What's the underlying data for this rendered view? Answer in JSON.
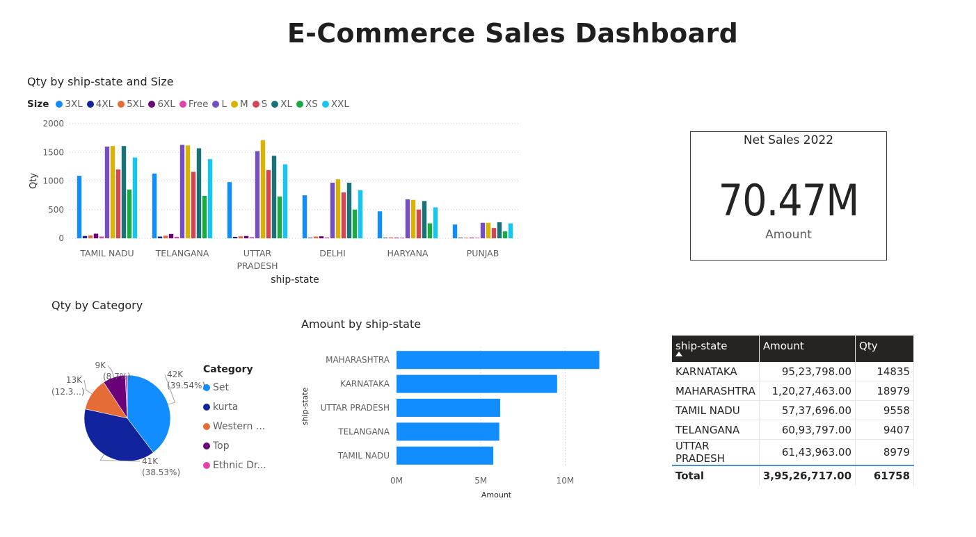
{
  "page": {
    "title": "E-Commerce Sales Dashboard"
  },
  "colors": {
    "3XL": "#118DFF",
    "4XL": "#12239E",
    "5XL": "#E66C37",
    "6XL": "#6B007B",
    "Free": "#E044A7",
    "L": "#744EC2",
    "M": "#D9B300",
    "S": "#D64550",
    "XL": "#197278",
    "XS": "#1AAB40",
    "XXL": "#15C6F4"
  },
  "size_chart": {
    "title": "Qty by ship-state and Size",
    "legend_title": "Size",
    "chart_data": {
      "type": "bar",
      "title": "Qty by ship-state and Size",
      "xlabel": "ship-state",
      "ylabel": "Qty",
      "ylim": [
        0,
        2000
      ],
      "yticks": [
        0,
        500,
        1000,
        1500,
        2000
      ],
      "grid": true,
      "legend": "top-left",
      "categories": [
        "TAMIL NADU",
        "TELANGANA",
        "UTTAR PRADESH",
        "DELHI",
        "HARYANA",
        "PUNJAB"
      ],
      "category_lines": [
        [
          "TAMIL NADU"
        ],
        [
          "TELANGANA"
        ],
        [
          "UTTAR",
          "PRADESH"
        ],
        [
          "DELHI"
        ],
        [
          "HARYANA"
        ],
        [
          "PUNJAB"
        ]
      ],
      "series": [
        {
          "name": "3XL",
          "values": [
            1090,
            1130,
            980,
            750,
            470,
            240
          ]
        },
        {
          "name": "4XL",
          "values": [
            40,
            30,
            25,
            10,
            10,
            10
          ]
        },
        {
          "name": "5XL",
          "values": [
            50,
            45,
            35,
            30,
            15,
            10
          ]
        },
        {
          "name": "6XL",
          "values": [
            80,
            75,
            40,
            35,
            10,
            10
          ]
        },
        {
          "name": "Free",
          "values": [
            30,
            25,
            20,
            15,
            10,
            10
          ]
        },
        {
          "name": "L",
          "values": [
            1600,
            1630,
            1520,
            970,
            680,
            270
          ]
        },
        {
          "name": "M",
          "values": [
            1610,
            1620,
            1710,
            1030,
            670,
            270
          ]
        },
        {
          "name": "S",
          "values": [
            1200,
            1160,
            1190,
            800,
            500,
            180
          ]
        },
        {
          "name": "XL",
          "values": [
            1610,
            1570,
            1440,
            970,
            650,
            280
          ]
        },
        {
          "name": "XS",
          "values": [
            850,
            740,
            730,
            500,
            260,
            120
          ]
        },
        {
          "name": "XXL",
          "values": [
            1410,
            1380,
            1290,
            840,
            540,
            260
          ]
        }
      ]
    }
  },
  "card": {
    "title": "Net Sales 2022",
    "value": "70.47M",
    "label": "Amount"
  },
  "category_chart": {
    "title": "Qty by Category",
    "legend_title": "Category",
    "legend_labels": [
      "Set",
      "kurta",
      "Western ...",
      "Top",
      "Ethnic Dr..."
    ],
    "chart_data": {
      "type": "pie",
      "title": "Qty by Category",
      "legend": "right",
      "slices": [
        {
          "label": "Set",
          "value": 42000,
          "color": "#118DFF"
        },
        {
          "label": "kurta",
          "value": 41000,
          "color": "#12239E"
        },
        {
          "label": "Western Dress",
          "value": 13000,
          "color": "#E66C37"
        },
        {
          "label": "Top",
          "value": 9000,
          "color": "#6B007B"
        },
        {
          "label": "Ethnic Dress",
          "value": 800,
          "color": "#E044A7"
        }
      ],
      "data_labels": [
        {
          "value": "42K",
          "pct": "(39.54%)"
        },
        {
          "value": "41K",
          "pct": "(38.53%)"
        },
        {
          "value": "13K",
          "pct": "(12.3...)"
        },
        {
          "value": "9K",
          "pct": "(8.7%)"
        }
      ]
    }
  },
  "amount_chart": {
    "title": "Amount by ship-state",
    "chart_data": {
      "type": "bar",
      "orientation": "horizontal",
      "title": "Amount by ship-state",
      "xlabel": "Amount",
      "ylabel": "ship-state",
      "xlim": [
        0,
        12500000
      ],
      "xticks": [
        0,
        5000000,
        10000000
      ],
      "xtick_labels": [
        "0M",
        "5M",
        "10M"
      ],
      "categories": [
        "MAHARASHTRA",
        "KARNATAKA",
        "UTTAR PRADESH",
        "TELANGANA",
        "TAMIL NADU"
      ],
      "values": [
        12027463,
        9523798,
        6143963,
        6093797,
        5737696
      ],
      "color": "#118DFF"
    }
  },
  "table": {
    "headers": [
      "ship-state",
      "Amount",
      "Qty"
    ],
    "rows": [
      [
        "KARNATAKA",
        "95,23,798.00",
        "14835"
      ],
      [
        "MAHARASHTRA",
        "1,20,27,463.00",
        "18979"
      ],
      [
        "TAMIL NADU",
        "57,37,696.00",
        "9558"
      ],
      [
        "TELANGANA",
        "60,93,797.00",
        "9407"
      ],
      [
        "UTTAR PRADESH",
        "61,43,963.00",
        "8979"
      ]
    ],
    "total": [
      "Total",
      "3,95,26,717.00",
      "61758"
    ]
  }
}
